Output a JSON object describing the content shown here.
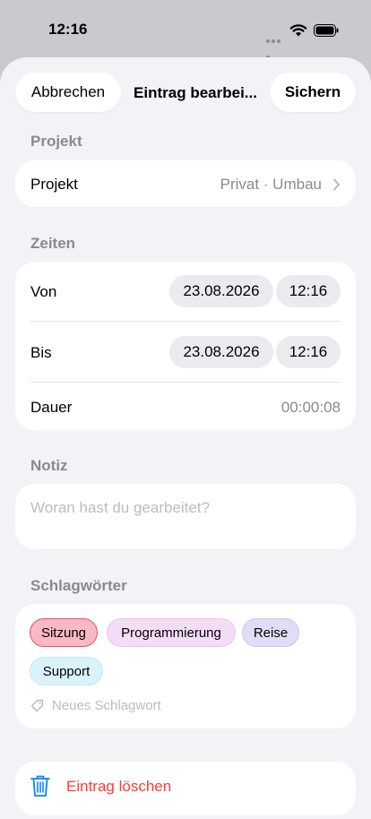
{
  "status": {
    "time": "12:16"
  },
  "nav": {
    "cancel": "Abbrechen",
    "title": "Eintrag bearbei...",
    "save": "Sichern"
  },
  "project": {
    "section": "Projekt",
    "label": "Projekt",
    "value": "Privat · Umbau"
  },
  "times": {
    "section": "Zeiten",
    "from": {
      "label": "Von",
      "date": "23.08.2026",
      "time": "12:16"
    },
    "to": {
      "label": "Bis",
      "date": "23.08.2026",
      "time": "12:16"
    },
    "duration": {
      "label": "Dauer",
      "value": "00:00:08"
    }
  },
  "note": {
    "section": "Notiz",
    "placeholder": "Woran hast du gearbeitet?"
  },
  "tags": {
    "section": "Schlagwörter",
    "items": [
      {
        "label": "Sitzung",
        "bg": "#f8b9c4",
        "border": "#e8506a",
        "selected": true
      },
      {
        "label": "Programmierung",
        "bg": "#f3dcf5",
        "border": "#e7c7ea",
        "selected": false
      },
      {
        "label": "Reise",
        "bg": "#e0ddf7",
        "border": "#cac5ee",
        "selected": false
      },
      {
        "label": "Support",
        "bg": "#daf3fb",
        "border": "#c2e8f3",
        "selected": false
      }
    ],
    "new_placeholder": "Neues Schlagwort"
  },
  "delete": {
    "label": "Eintrag löschen",
    "color": "#ff3b30"
  }
}
